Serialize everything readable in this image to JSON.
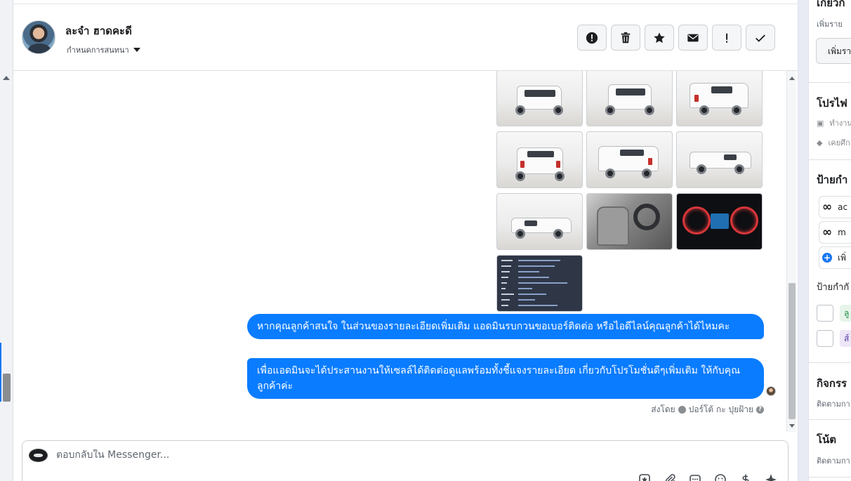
{
  "header": {
    "contact_name": "ละจำ ฮาดคะดี",
    "assign_label": "กำหนดการสนทนา",
    "actions": [
      {
        "name": "report-button",
        "icon": "alert-circle-icon",
        "glyph": "!"
      },
      {
        "name": "delete-button",
        "icon": "trash-icon"
      },
      {
        "name": "star-button",
        "icon": "star-icon"
      },
      {
        "name": "mark-unread-button",
        "icon": "envelope-icon"
      },
      {
        "name": "follow-up-button",
        "icon": "exclamation-icon",
        "glyph": "!"
      },
      {
        "name": "mark-done-button",
        "icon": "check-icon"
      }
    ]
  },
  "conversation": {
    "messages": [
      {
        "text": "หากคุณลูกค้าสนใจ ในส่วนของรายละเอียดเพิ่มเติม แอดมินรบกวนขอเบอร์ติดต่อ หรือไอดีไลน์คุณลูกค้าได้ไหมคะ"
      },
      {
        "text": "เพื่อแอดมินจะได้ประสานงานให้เซลล์ได้ติดต่อดูแลพร้อมทั้งชี้แจงรายละเอียด เกี่ยวกับโปรโมชั่นดีๆเพิ่มเติม ให้กับคุณลูกค้าค่ะ"
      }
    ],
    "sent_by_label": "ส่งโดย",
    "sent_by_name": "ปอร์โต้ กะ ปุยฝ้าย",
    "info_glyph": "?",
    "images": [
      {
        "kind": "truck-front"
      },
      {
        "kind": "truck-front"
      },
      {
        "kind": "truck-rear"
      },
      {
        "kind": "truck-rear"
      },
      {
        "kind": "truck-rear"
      },
      {
        "kind": "truck-side"
      },
      {
        "kind": "truck-side"
      },
      {
        "kind": "interior"
      },
      {
        "kind": "dashboard"
      },
      {
        "kind": "document"
      }
    ]
  },
  "composer": {
    "placeholder": "ตอบกลับใน Messenger..."
  },
  "right_panel": {
    "section_top_partial": "เกี่ยวกั",
    "add_detail_sub": "เพิ่มราย",
    "add_detail_button": "เพิ่มรา",
    "profile_title": "โปรไฟ",
    "profile_work": "ทำงาน",
    "profile_edu": "เคยศึก",
    "labels_title": "ป้ายกำ",
    "label_1": "ac",
    "label_2": "m",
    "add_label": "เพิ่",
    "suggested_labels_title": "ป้ายกำกั",
    "suggest_1": "ลู",
    "suggest_2": "ส์",
    "activity_title": "กิจกรร",
    "activity_sub": "ติดตามกา",
    "notes_title": "โน้ต",
    "notes_sub": "ติดตามกา"
  },
  "colors": {
    "bubble": "#0a7cff",
    "accent": "#1877f2",
    "label_green_bg": "#e6f4ea",
    "label_green_fg": "#1e8e3e",
    "label_purple_bg": "#ece6f7",
    "label_purple_fg": "#5b3fa0"
  }
}
